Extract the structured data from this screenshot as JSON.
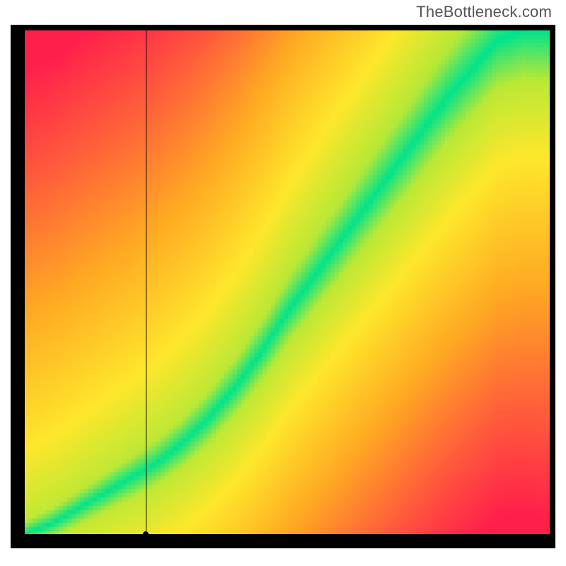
{
  "watermark": "TheBottleneck.com",
  "chart_data": {
    "type": "heatmap",
    "title": "",
    "xlabel": "",
    "ylabel": "",
    "xlim": [
      0,
      100
    ],
    "ylim": [
      0,
      100
    ],
    "ridge": [
      {
        "x": 0,
        "y": 0
      },
      {
        "x": 5,
        "y": 2
      },
      {
        "x": 10,
        "y": 5
      },
      {
        "x": 15,
        "y": 8
      },
      {
        "x": 20,
        "y": 11
      },
      {
        "x": 25,
        "y": 14
      },
      {
        "x": 30,
        "y": 18
      },
      {
        "x": 35,
        "y": 23
      },
      {
        "x": 40,
        "y": 29
      },
      {
        "x": 45,
        "y": 36
      },
      {
        "x": 50,
        "y": 44
      },
      {
        "x": 55,
        "y": 51
      },
      {
        "x": 60,
        "y": 58
      },
      {
        "x": 65,
        "y": 65
      },
      {
        "x": 70,
        "y": 72
      },
      {
        "x": 75,
        "y": 79
      },
      {
        "x": 80,
        "y": 86
      },
      {
        "x": 85,
        "y": 92
      },
      {
        "x": 90,
        "y": 98
      },
      {
        "x": 95,
        "y": 100
      },
      {
        "x": 100,
        "y": 100
      }
    ],
    "ridge_width_frac": 0.06,
    "marker": {
      "x": 23,
      "y": 0
    },
    "color_stops": [
      {
        "t": 0.0,
        "color": "#00E38C"
      },
      {
        "t": 0.15,
        "color": "#B9E836"
      },
      {
        "t": 0.3,
        "color": "#FEE72B"
      },
      {
        "t": 0.55,
        "color": "#FFA923"
      },
      {
        "t": 0.8,
        "color": "#FF5A3C"
      },
      {
        "t": 1.0,
        "color": "#FF1F4B"
      }
    ]
  }
}
